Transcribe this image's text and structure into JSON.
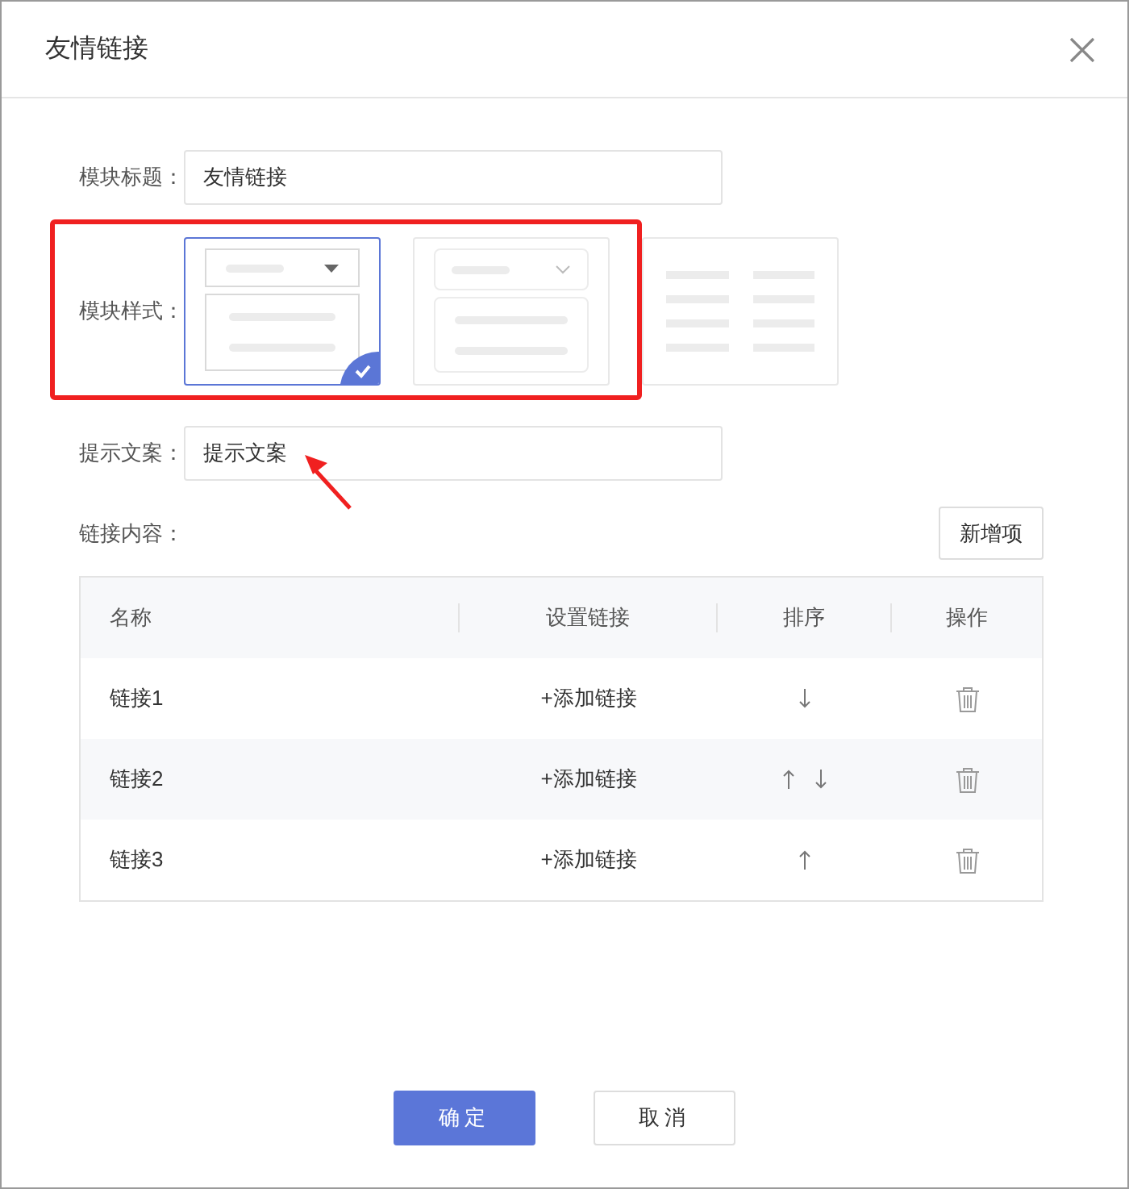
{
  "dialog": {
    "title": "友情链接"
  },
  "form": {
    "title_label": "模块标题：",
    "title_value": "友情链接",
    "style_label": "模块样式：",
    "hint_label": "提示文案：",
    "hint_value": "提示文案",
    "content_label": "链接内容："
  },
  "styles": [
    {
      "kind": "select-square",
      "selected": true
    },
    {
      "kind": "select-round",
      "selected": false
    },
    {
      "kind": "list-grid",
      "selected": false
    }
  ],
  "add_button": "新增项",
  "table": {
    "columns": [
      "名称",
      "设置链接",
      "排序",
      "操作"
    ],
    "rows": [
      {
        "name": "链接1",
        "link": "+添加链接",
        "up": false,
        "down": true
      },
      {
        "name": "链接2",
        "link": "+添加链接",
        "up": true,
        "down": true
      },
      {
        "name": "链接3",
        "link": "+添加链接",
        "up": true,
        "down": false
      }
    ]
  },
  "buttons": {
    "ok": "确定",
    "cancel": "取消"
  }
}
